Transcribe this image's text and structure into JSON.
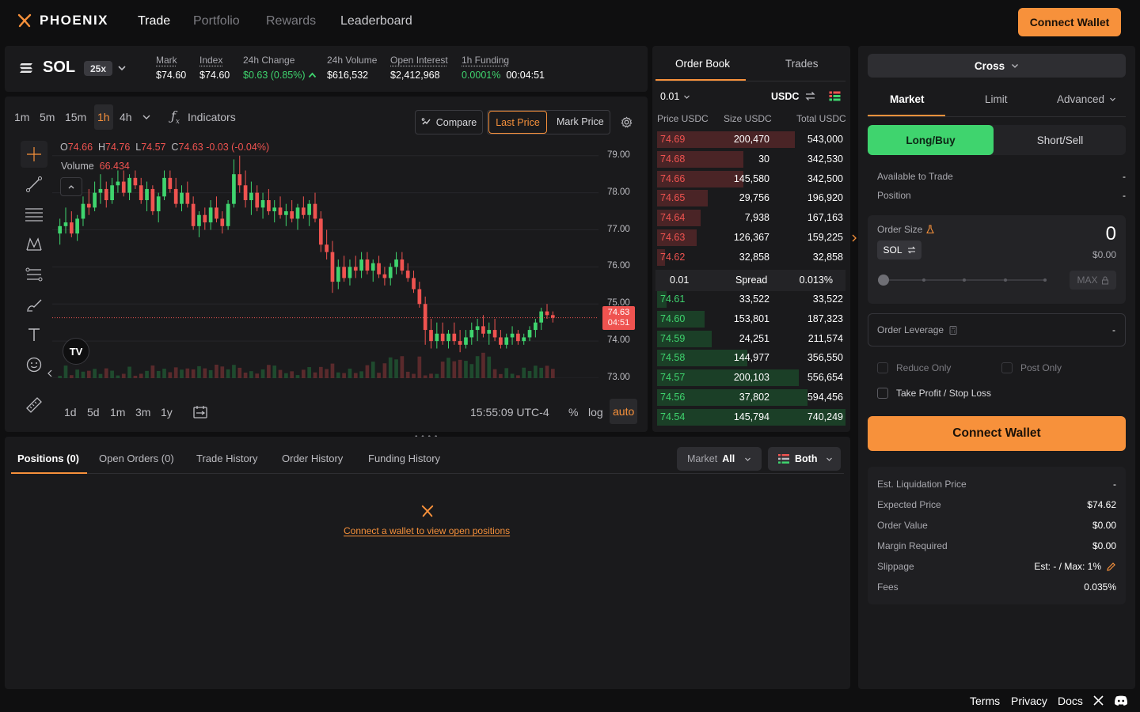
{
  "brand": {
    "name": "PHOENIX",
    "accent": "#f7913b",
    "green": "#3fd46e",
    "red": "#ef5350"
  },
  "nav": {
    "items": [
      "Trade",
      "Portfolio",
      "Rewards",
      "Leaderboard"
    ],
    "connect": "Connect Wallet"
  },
  "market": {
    "pair": "SOL",
    "leverage": "25x",
    "stats": [
      {
        "label": "Mark",
        "value": "$74.60"
      },
      {
        "label": "Index",
        "value": "$74.60"
      },
      {
        "label": "24h Change",
        "value": "$0.63 (0.85%)"
      },
      {
        "label": "24h Volume",
        "value": "$616,532"
      },
      {
        "label": "Open Interest",
        "value": "$2,412,968"
      },
      {
        "label": "1h Funding",
        "value": "0.0001%",
        "value2": "00:04:51"
      }
    ]
  },
  "chart": {
    "timeframes": [
      "1m",
      "5m",
      "15m",
      "1h",
      "4h"
    ],
    "active_tf": "1h",
    "indicators": "Indicators",
    "compare": "Compare",
    "last_price": "Last Price",
    "mark_price": "Mark Price",
    "ohlc": {
      "o_label": "O",
      "o": "74.66",
      "h_label": "H",
      "h": "74.76",
      "l_label": "L",
      "l": "74.57",
      "c_label": "C",
      "c": "74.63",
      "chg": "-0.03 (-0.04%)"
    },
    "volume_label": "Volume",
    "volume_value": "66.434",
    "price_axis": [
      "79.00",
      "78.00",
      "77.00",
      "76.00",
      "75.00",
      "74.00",
      "73.00"
    ],
    "last_price_tag": "74.63",
    "countdown_tag": "04:51",
    "ranges": [
      "1d",
      "5d",
      "1m",
      "3m",
      "1y"
    ],
    "time": "15:55:09 UTC-4",
    "pct": "%",
    "log": "log",
    "auto": "auto"
  },
  "chart_data": {
    "type": "candlestick",
    "ylim": [
      73.0,
      79.4
    ],
    "title": "",
    "series": [
      {
        "values": [
          [
            76.9,
            77.3,
            76.6,
            77.1
          ],
          [
            77.1,
            77.6,
            76.9,
            77.2
          ],
          [
            77.2,
            77.5,
            76.8,
            76.9
          ],
          [
            76.9,
            77.4,
            76.7,
            77.3
          ],
          [
            77.3,
            77.9,
            77.1,
            77.7
          ],
          [
            77.7,
            78.1,
            77.4,
            77.6
          ],
          [
            77.6,
            78.3,
            77.5,
            78.0
          ],
          [
            78.0,
            78.5,
            77.7,
            78.1
          ],
          [
            78.1,
            78.3,
            77.6,
            77.8
          ],
          [
            77.8,
            78.4,
            77.7,
            78.2
          ],
          [
            78.2,
            78.6,
            78.0,
            78.3
          ],
          [
            78.3,
            78.6,
            77.9,
            78.0
          ],
          [
            78.0,
            78.5,
            77.8,
            78.4
          ],
          [
            78.4,
            78.6,
            78.1,
            78.2
          ],
          [
            78.2,
            78.4,
            77.7,
            77.8
          ],
          [
            77.8,
            78.3,
            77.5,
            78.1
          ],
          [
            78.1,
            78.2,
            77.4,
            77.5
          ],
          [
            77.5,
            78.0,
            77.2,
            77.9
          ],
          [
            77.9,
            78.6,
            77.8,
            78.4
          ],
          [
            78.4,
            78.6,
            78.0,
            78.1
          ],
          [
            78.1,
            78.4,
            77.6,
            77.7
          ],
          [
            77.7,
            78.2,
            77.5,
            78.0
          ],
          [
            78.0,
            78.3,
            77.6,
            77.7
          ],
          [
            77.7,
            77.9,
            77.0,
            77.1
          ],
          [
            77.1,
            77.5,
            76.8,
            77.4
          ],
          [
            77.4,
            77.6,
            77.0,
            77.2
          ],
          [
            77.2,
            77.8,
            77.0,
            77.6
          ],
          [
            77.6,
            77.9,
            77.2,
            77.3
          ],
          [
            77.3,
            77.5,
            76.9,
            77.1
          ],
          [
            77.1,
            77.8,
            77.0,
            77.7
          ],
          [
            77.7,
            78.9,
            77.6,
            78.5
          ],
          [
            78.5,
            79.0,
            78.0,
            78.2
          ],
          [
            78.2,
            78.6,
            77.6,
            77.8
          ],
          [
            77.8,
            78.3,
            77.4,
            78.0
          ],
          [
            78.0,
            78.2,
            77.5,
            77.6
          ],
          [
            77.6,
            78.0,
            77.3,
            77.8
          ],
          [
            77.8,
            78.1,
            77.4,
            77.5
          ],
          [
            77.5,
            77.8,
            77.2,
            77.6
          ],
          [
            77.6,
            77.9,
            77.3,
            77.4
          ],
          [
            77.4,
            77.7,
            77.1,
            77.5
          ],
          [
            77.5,
            77.8,
            77.2,
            77.3
          ],
          [
            77.3,
            77.7,
            77.0,
            77.6
          ],
          [
            77.6,
            77.9,
            77.3,
            77.4
          ],
          [
            77.4,
            77.8,
            77.1,
            77.7
          ],
          [
            77.7,
            78.0,
            77.2,
            77.3
          ],
          [
            77.3,
            77.5,
            76.4,
            76.6
          ],
          [
            76.6,
            77.0,
            76.2,
            76.4
          ],
          [
            76.4,
            76.7,
            75.3,
            75.6
          ],
          [
            75.6,
            76.2,
            75.4,
            76.0
          ],
          [
            76.0,
            76.3,
            75.6,
            75.7
          ],
          [
            75.7,
            76.2,
            75.5,
            76.0
          ],
          [
            76.0,
            76.3,
            75.7,
            75.9
          ],
          [
            75.9,
            76.4,
            75.7,
            76.2
          ],
          [
            76.2,
            76.4,
            75.8,
            75.9
          ],
          [
            75.9,
            76.2,
            75.6,
            76.1
          ],
          [
            76.1,
            76.3,
            75.7,
            75.8
          ],
          [
            75.8,
            76.0,
            75.5,
            75.7
          ],
          [
            75.7,
            76.1,
            75.5,
            76.0
          ],
          [
            76.0,
            76.4,
            75.8,
            76.2
          ],
          [
            76.2,
            76.4,
            75.8,
            75.9
          ],
          [
            75.9,
            76.1,
            75.6,
            75.7
          ],
          [
            75.7,
            75.9,
            75.3,
            75.4
          ],
          [
            75.4,
            75.6,
            74.9,
            75.0
          ],
          [
            75.0,
            75.2,
            73.9,
            74.3
          ],
          [
            74.3,
            74.6,
            73.8,
            74.0
          ],
          [
            74.0,
            74.5,
            73.8,
            74.2
          ],
          [
            74.2,
            74.5,
            73.9,
            74.0
          ],
          [
            74.0,
            74.3,
            73.8,
            74.2
          ],
          [
            74.2,
            74.5,
            73.9,
            74.0
          ],
          [
            74.0,
            74.3,
            73.7,
            73.9
          ],
          [
            73.9,
            74.3,
            73.8,
            74.1
          ],
          [
            74.1,
            74.5,
            73.9,
            74.3
          ],
          [
            74.3,
            74.6,
            74.0,
            74.4
          ],
          [
            74.4,
            74.7,
            74.1,
            74.2
          ],
          [
            74.2,
            74.5,
            73.9,
            74.3
          ],
          [
            74.3,
            74.6,
            74.0,
            74.1
          ],
          [
            74.1,
            74.3,
            73.8,
            73.9
          ],
          [
            73.9,
            74.2,
            73.8,
            74.1
          ],
          [
            74.1,
            74.4,
            73.9,
            74.2
          ],
          [
            74.2,
            74.3,
            73.9,
            74.0
          ],
          [
            74.0,
            74.2,
            73.9,
            74.1
          ],
          [
            74.1,
            74.4,
            74.0,
            74.3
          ],
          [
            74.3,
            74.6,
            74.1,
            74.5
          ],
          [
            74.5,
            74.9,
            74.3,
            74.8
          ],
          [
            74.8,
            75.0,
            74.6,
            74.7
          ],
          [
            74.7,
            74.8,
            74.5,
            74.63
          ]
        ]
      }
    ]
  },
  "orderbook": {
    "tabs": [
      "Order Book",
      "Trades"
    ],
    "tick": "0.01",
    "currency": "USDC",
    "headers": [
      "Price USDC",
      "Size USDC",
      "Total USDC"
    ],
    "asks": [
      {
        "price": "74.69",
        "size": "200,470",
        "total": "543,000",
        "depth": 0.73
      },
      {
        "price": "74.68",
        "size": "30",
        "total": "342,530",
        "depth": 0.46
      },
      {
        "price": "74.66",
        "size": "145,580",
        "total": "342,500",
        "depth": 0.46
      },
      {
        "price": "74.65",
        "size": "29,756",
        "total": "196,920",
        "depth": 0.27
      },
      {
        "price": "74.64",
        "size": "7,938",
        "total": "167,163",
        "depth": 0.23
      },
      {
        "price": "74.63",
        "size": "126,367",
        "total": "159,225",
        "depth": 0.21
      },
      {
        "price": "74.62",
        "size": "32,858",
        "total": "32,858",
        "depth": 0.04
      }
    ],
    "spread": {
      "tick": "0.01",
      "label": "Spread",
      "value": "0.013%"
    },
    "bids": [
      {
        "price": "74.61",
        "size": "33,522",
        "total": "33,522",
        "depth": 0.05
      },
      {
        "price": "74.60",
        "size": "153,801",
        "total": "187,323",
        "depth": 0.25
      },
      {
        "price": "74.59",
        "size": "24,251",
        "total": "211,574",
        "depth": 0.29
      },
      {
        "price": "74.58",
        "size": "144,977",
        "total": "356,550",
        "depth": 0.48
      },
      {
        "price": "74.57",
        "size": "200,103",
        "total": "556,654",
        "depth": 0.75
      },
      {
        "price": "74.56",
        "size": "37,802",
        "total": "594,456",
        "depth": 0.8
      },
      {
        "price": "74.54",
        "size": "145,794",
        "total": "740,249",
        "depth": 1.0
      }
    ]
  },
  "positions": {
    "tabs": [
      "Positions (0)",
      "Open Orders (0)",
      "Trade History",
      "Order History",
      "Funding History"
    ],
    "filter_market_label": "Market",
    "filter_market_value": "All",
    "filter_side": "Both",
    "empty": "Connect a wallet to view open positions"
  },
  "trade": {
    "margin_mode": "Cross",
    "order_types": [
      "Market",
      "Limit",
      "Advanced"
    ],
    "sides": [
      "Long/Buy",
      "Short/Sell"
    ],
    "available_label": "Available to Trade",
    "available_value": "-",
    "position_label": "Position",
    "position_value": "-",
    "order_size_label": "Order Size",
    "order_size_value": "0",
    "order_size_usd": "$0.00",
    "size_unit": "SOL",
    "max_label": "MAX",
    "leverage_label": "Order Leverage",
    "leverage_value": "-",
    "reduce_only": "Reduce Only",
    "post_only": "Post Only",
    "tpsl": "Take Profit / Stop Loss",
    "connect": "Connect Wallet",
    "summary": [
      {
        "label": "Est. Liquidation Price",
        "value": "-"
      },
      {
        "label": "Expected Price",
        "value": "$74.62"
      },
      {
        "label": "Order Value",
        "value": "$0.00"
      },
      {
        "label": "Margin Required",
        "value": "$0.00"
      },
      {
        "label": "Slippage",
        "value": "Est: - / Max: 1%"
      },
      {
        "label": "Fees",
        "value": "0.035%"
      }
    ]
  },
  "footer": {
    "links": [
      "Terms",
      "Privacy",
      "Docs"
    ]
  }
}
